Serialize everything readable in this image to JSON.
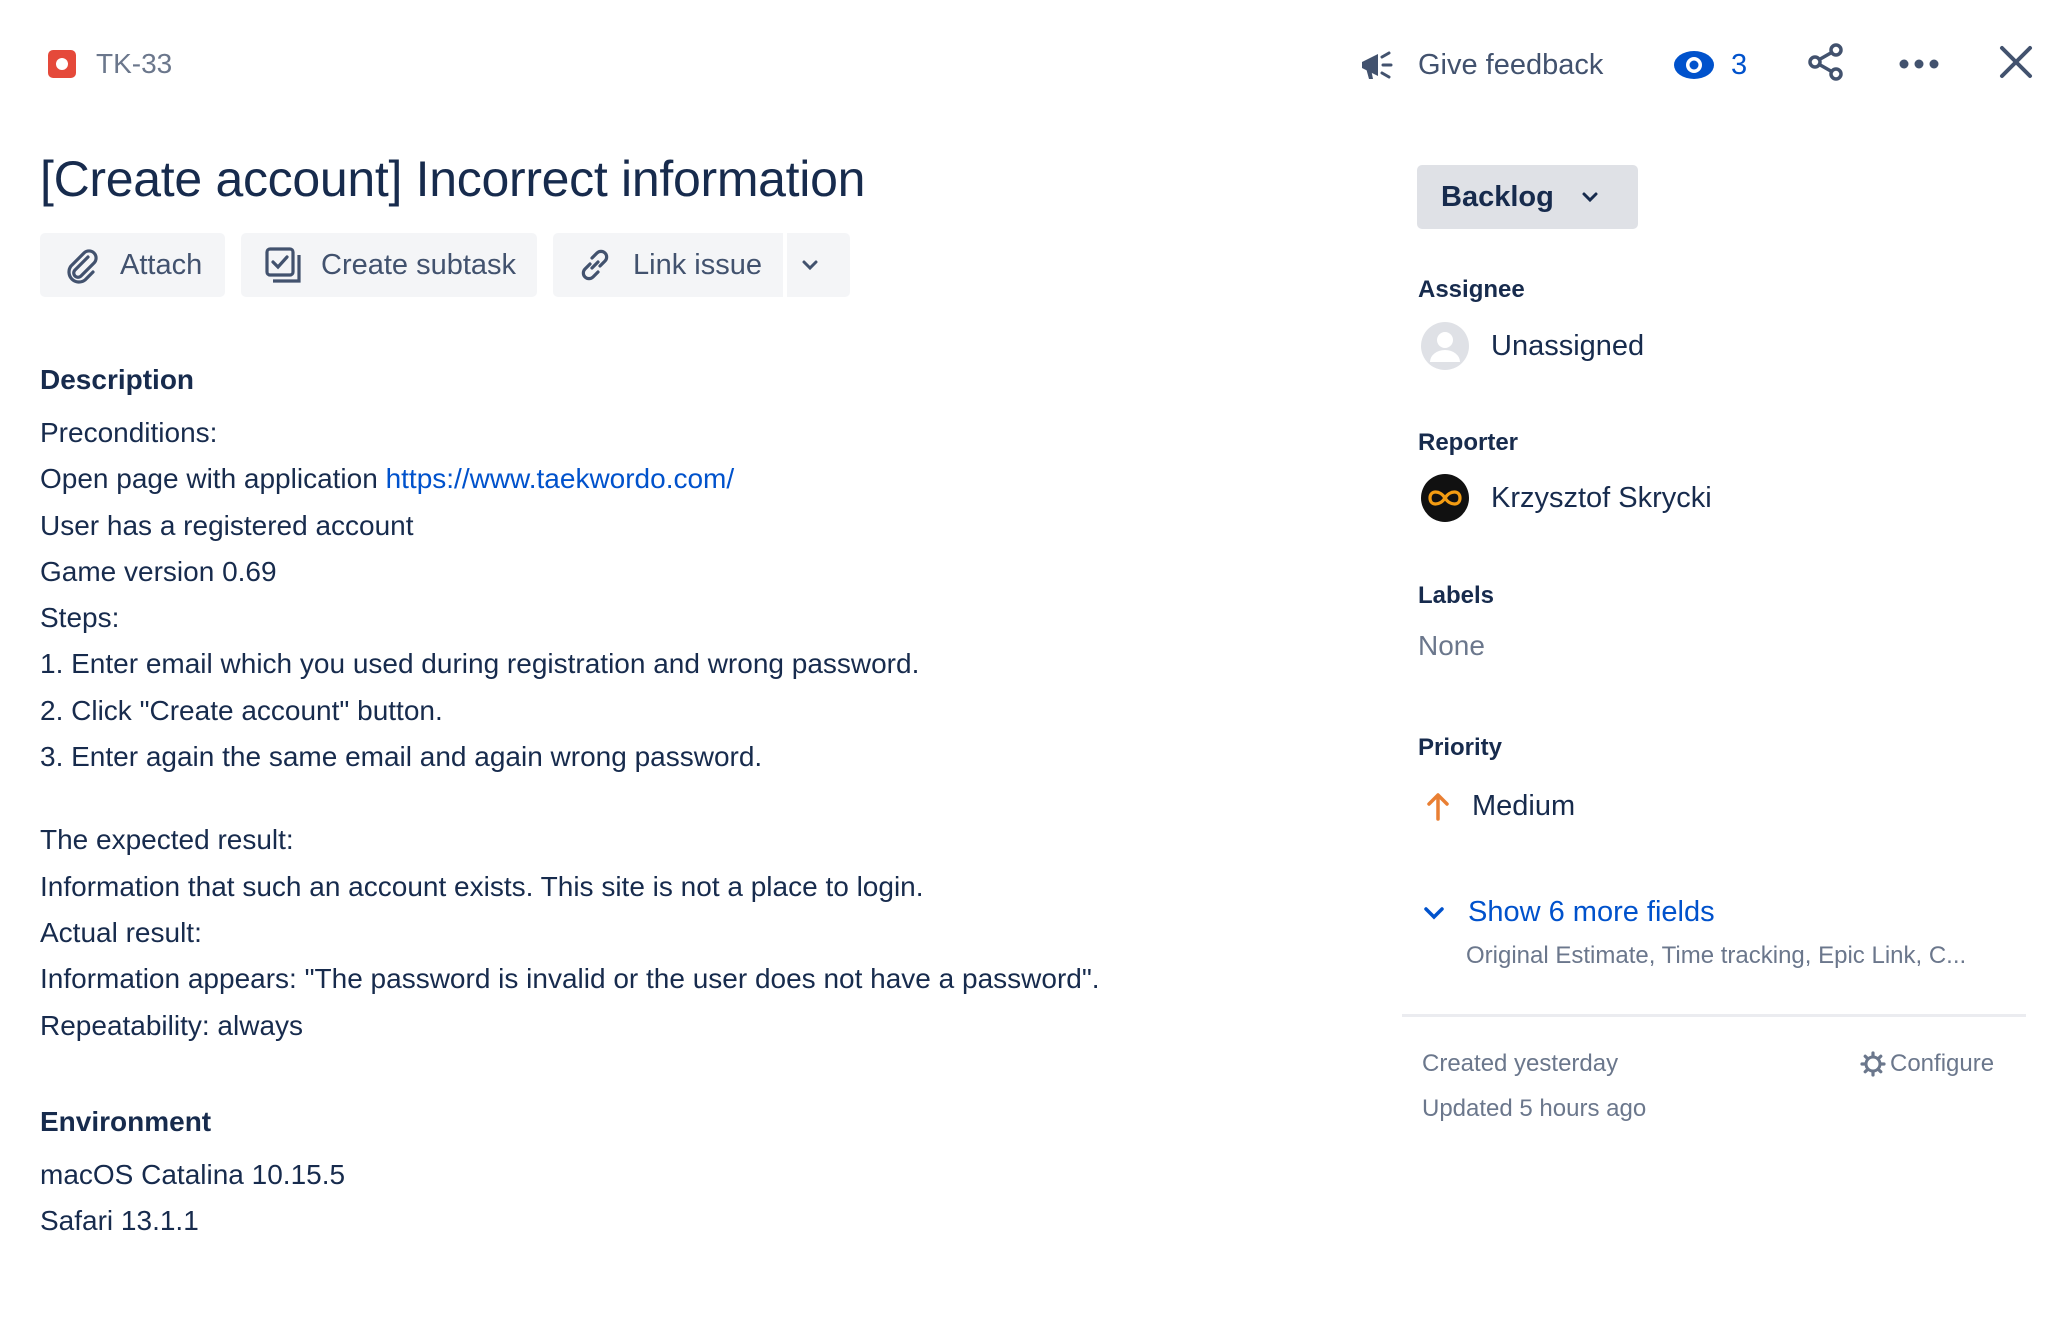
{
  "header": {
    "issue_key": "TK-33",
    "feedback_label": "Give feedback",
    "watch_count": "3"
  },
  "issue": {
    "title": "[Create account] Incorrect information"
  },
  "actions": {
    "attach": "Attach",
    "create_subtask": "Create subtask",
    "link_issue": "Link issue"
  },
  "description": {
    "heading": "Description",
    "lines": [
      "Preconditions:",
      "Open page with application ",
      "User has a registered account",
      "Game version 0.69",
      "Steps:",
      "1. Enter email which you used during registration and wrong password.",
      "2. Click \"Create account\" button.",
      "3. Enter again the same email and again wrong password.",
      "The expected result:",
      "Information that such an account exists. This site is not a place to login.",
      "Actual result:",
      "Information appears: \"The password is invalid or the user does not have a password\".",
      "Repeatability: always"
    ],
    "link": "https://www.taekwordo.com/"
  },
  "environment": {
    "heading": "Environment",
    "lines": [
      "macOS Catalina 10.15.5",
      "Safari 13.1.1"
    ]
  },
  "sidebar": {
    "status": "Backlog",
    "assignee_label": "Assignee",
    "assignee_value": "Unassigned",
    "reporter_label": "Reporter",
    "reporter_value": "Krzysztof Skrycki",
    "labels_label": "Labels",
    "labels_value": "None",
    "priority_label": "Priority",
    "priority_value": "Medium",
    "priority_color": "#E97F33",
    "more_fields_label": "Show 6 more fields",
    "more_fields_sub": "Original Estimate, Time tracking, Epic Link, C...",
    "created": "Created yesterday",
    "updated": "Updated 5 hours ago",
    "configure": "Configure"
  },
  "colors": {
    "link": "#0052CC",
    "bug": "#E5493A",
    "text": "#172B4D",
    "muted": "#6B778C"
  },
  "icons": [
    "bug-icon",
    "megaphone-icon",
    "eye-icon",
    "share-icon",
    "more-icon",
    "close-icon",
    "paperclip-icon",
    "subtask-icon",
    "link-icon",
    "chevron-down-icon",
    "user-avatar-icon",
    "arrow-up-icon",
    "gear-icon"
  ]
}
